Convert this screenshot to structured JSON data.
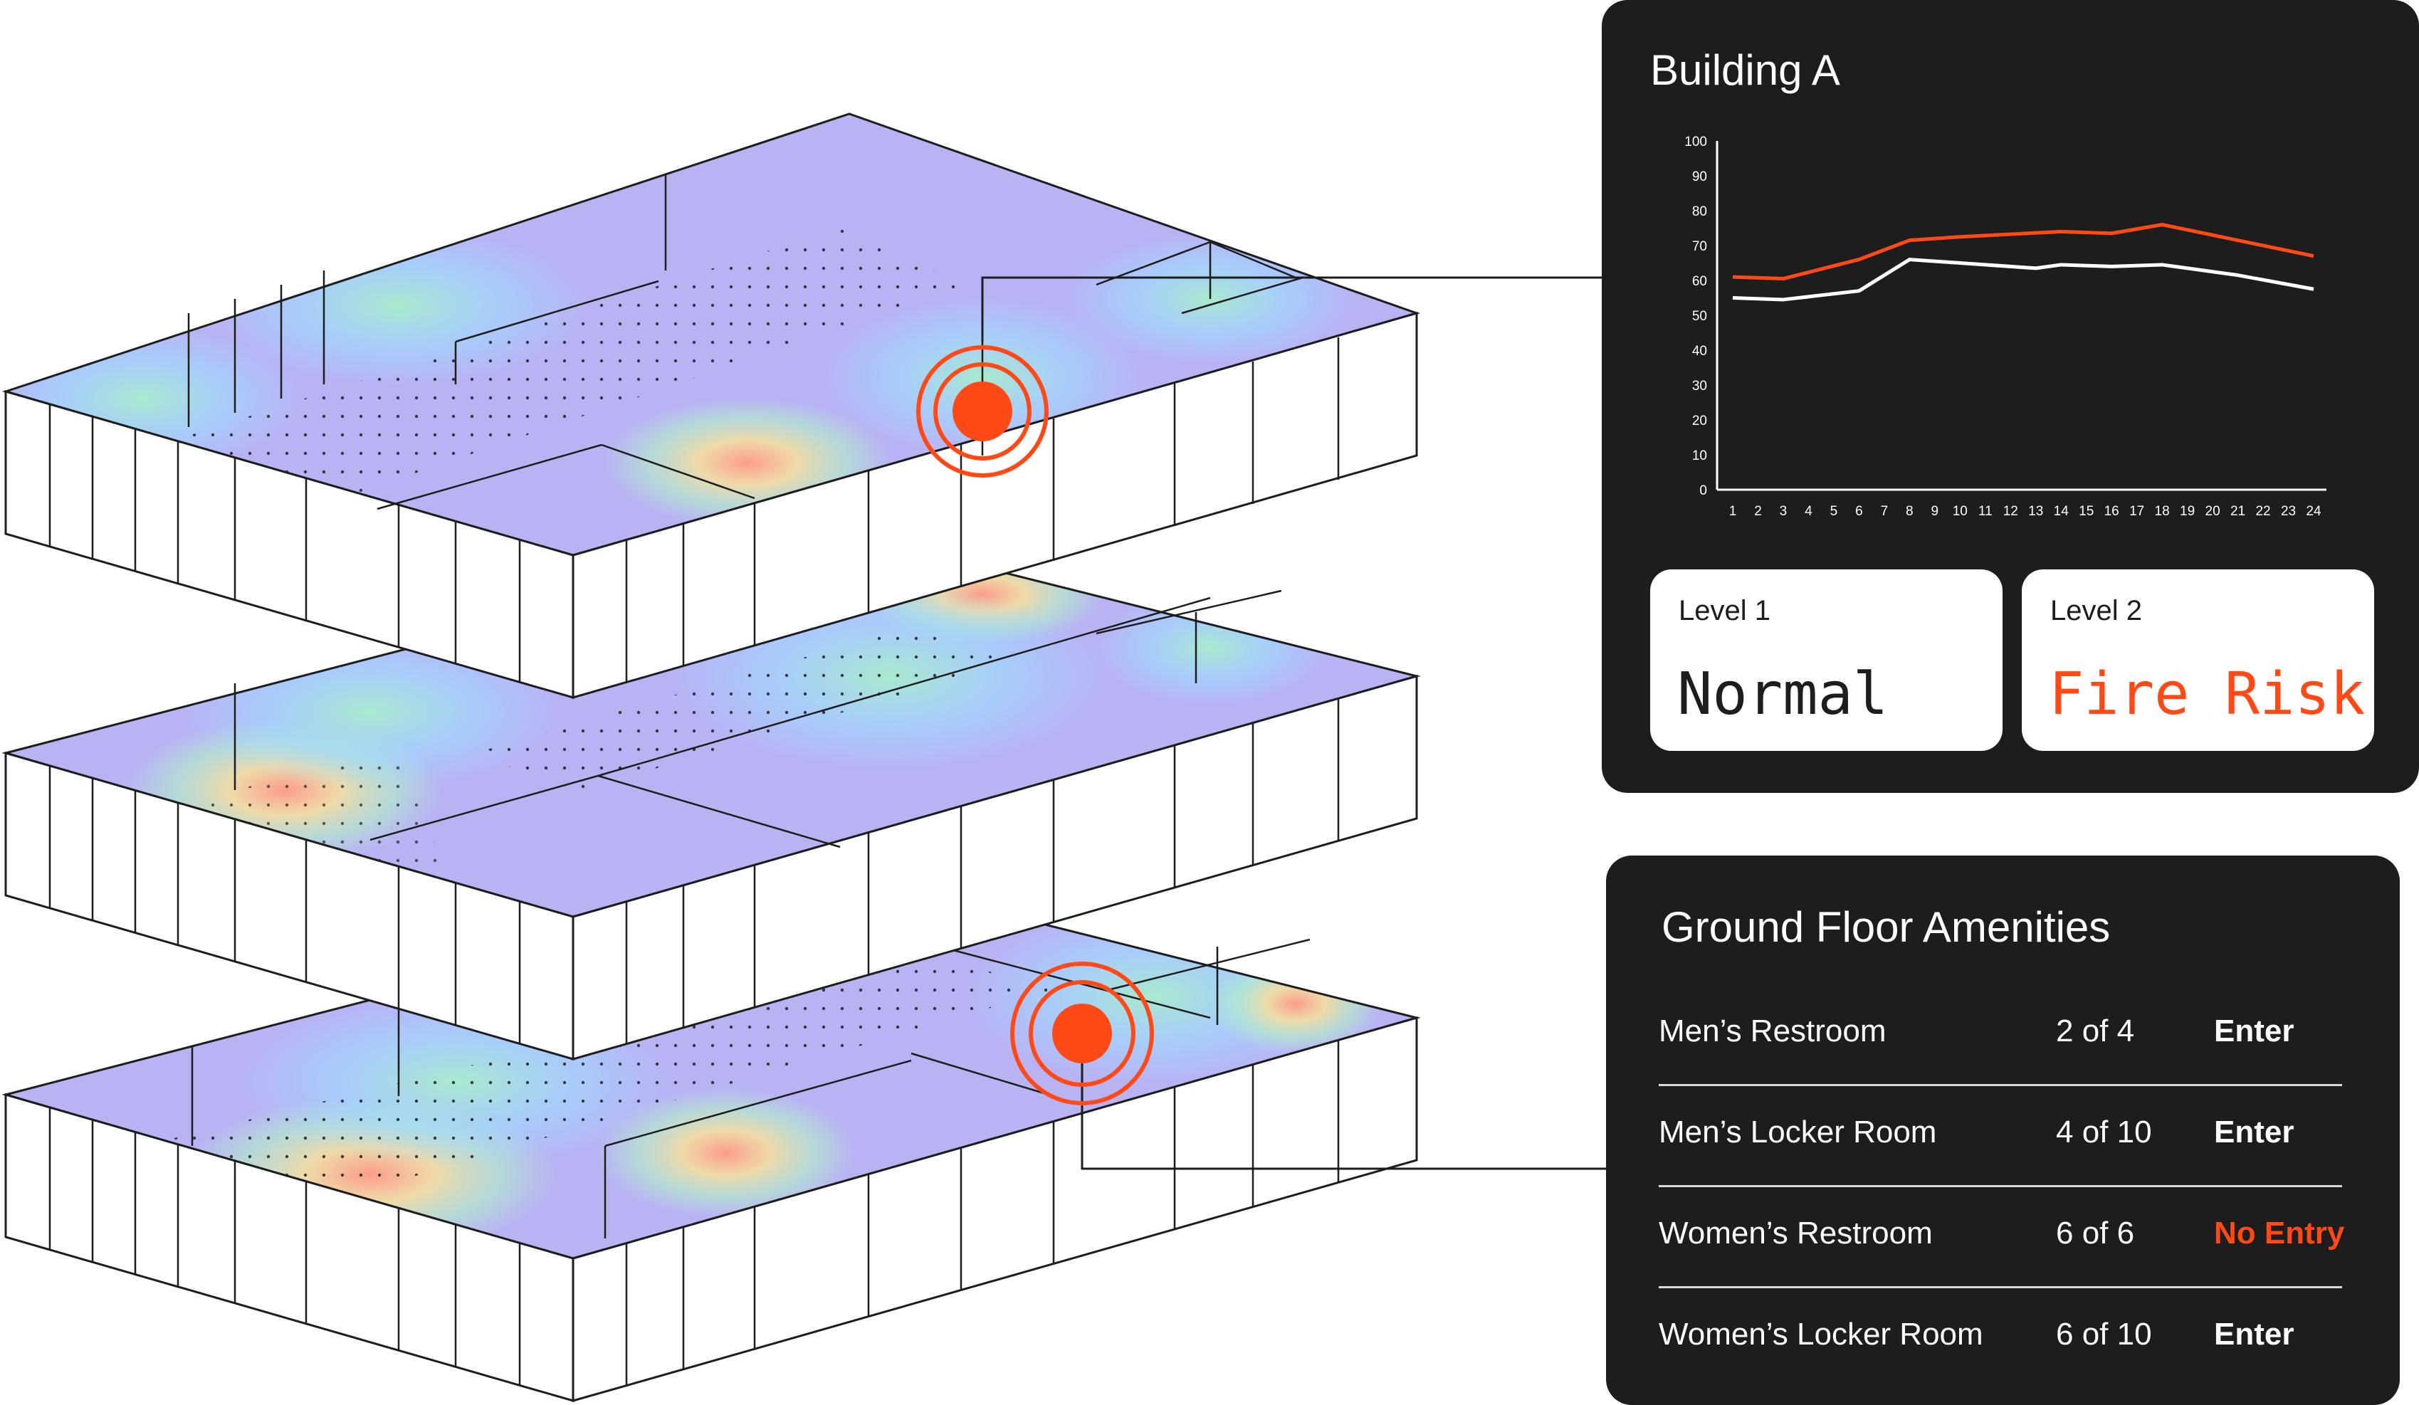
{
  "building_panel": {
    "title": "Building A",
    "levels": [
      {
        "name": "Level 1",
        "status": "Normal",
        "status_color": "#1d1d1d"
      },
      {
        "name": "Level 2",
        "status": "Fire Risk",
        "status_color": "#ff4a17"
      }
    ]
  },
  "chart_data": {
    "type": "line",
    "x": [
      1,
      2,
      3,
      4,
      5,
      6,
      7,
      8,
      9,
      10,
      11,
      12,
      13,
      14,
      15,
      16,
      17,
      18,
      19,
      20,
      21,
      22,
      23,
      24
    ],
    "ylim": [
      0,
      100
    ],
    "yticks": [
      0,
      10,
      20,
      30,
      40,
      50,
      60,
      70,
      80,
      90,
      100
    ],
    "grid": false,
    "legend": "none",
    "series": [
      {
        "color": "#ff4a17",
        "points": [
          [
            1,
            61
          ],
          [
            3,
            60.5
          ],
          [
            6,
            66
          ],
          [
            8,
            71.5
          ],
          [
            10,
            72.5
          ],
          [
            14,
            74
          ],
          [
            16,
            73.5
          ],
          [
            18,
            76
          ],
          [
            24,
            67
          ]
        ]
      },
      {
        "color": "#ffffff",
        "points": [
          [
            1,
            55
          ],
          [
            3,
            54.5
          ],
          [
            6,
            57
          ],
          [
            8,
            66
          ],
          [
            10,
            65
          ],
          [
            13,
            63.5
          ],
          [
            14,
            64.5
          ],
          [
            16,
            64
          ],
          [
            18,
            64.5
          ],
          [
            21,
            61.5
          ],
          [
            24,
            57.5
          ]
        ]
      }
    ]
  },
  "amenities_panel": {
    "title": "Ground Floor Amenities",
    "rows": [
      {
        "name": "Men’s Restroom",
        "count": "2 of 4",
        "action": "Enter",
        "action_color": "#ffffff"
      },
      {
        "name": "Men’s Locker Room",
        "count": "4 of 10",
        "action": "Enter",
        "action_color": "#ffffff"
      },
      {
        "name": "Women’s Restroom",
        "count": "6 of 6",
        "action": "No Entry",
        "action_color": "#ff4a17"
      },
      {
        "name": "Women’s Locker Room",
        "count": "6 of 10",
        "action": "Enter",
        "action_color": "#ffffff"
      }
    ]
  },
  "colors": {
    "panel_bg": "#1d1d1d",
    "alert": "#ff4a17",
    "floor_base": "#b8b4f4",
    "heat_cool": "#9ed8ff",
    "heat_mid": "#b9f0c4",
    "heat_warm": "#f7e29a",
    "heat_hot": "#ffab8c"
  },
  "icons": {
    "alert": "fire-alert-icon"
  }
}
